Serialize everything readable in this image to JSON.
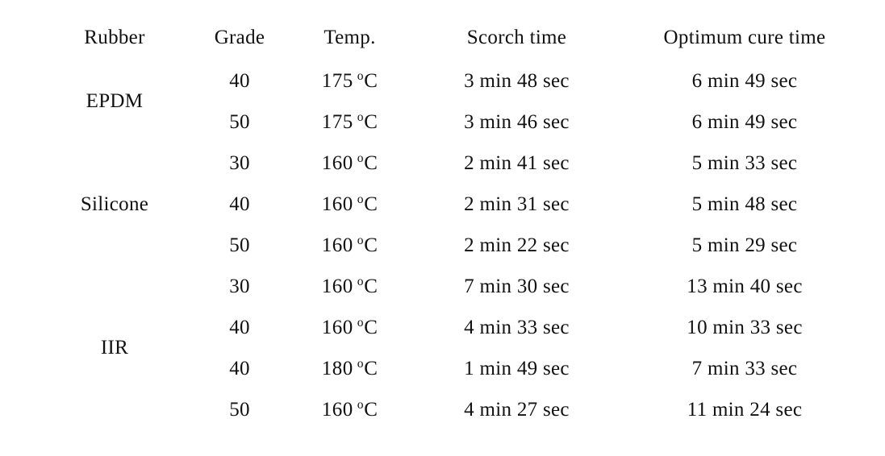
{
  "table": {
    "name": "rubber-cure-characteristics-table",
    "columns": [
      {
        "key": "rubber",
        "label": "Rubber"
      },
      {
        "key": "grade",
        "label": "Grade"
      },
      {
        "key": "temp",
        "label": "Temp."
      },
      {
        "key": "scorch",
        "label": "Scorch time"
      },
      {
        "key": "optimum",
        "label": "Optimum cure time"
      }
    ],
    "groups": [
      {
        "rubber": "EPDM",
        "rows": [
          {
            "grade": "40",
            "temp_value": "175",
            "temp_unit": "C",
            "scorch": "3 min 48 sec",
            "optimum": "6 min 49 sec"
          },
          {
            "grade": "50",
            "temp_value": "175",
            "temp_unit": "C",
            "scorch": "3 min 46 sec",
            "optimum": "6 min 49 sec"
          }
        ]
      },
      {
        "rubber": "Silicone",
        "rows": [
          {
            "grade": "30",
            "temp_value": "160",
            "temp_unit": "C",
            "scorch": "2 min 41 sec",
            "optimum": "5 min 33 sec"
          },
          {
            "grade": "40",
            "temp_value": "160",
            "temp_unit": "C",
            "scorch": "2 min 31 sec",
            "optimum": "5 min 48 sec"
          },
          {
            "grade": "50",
            "temp_value": "160",
            "temp_unit": "C",
            "scorch": "2 min 22 sec",
            "optimum": "5 min 29 sec"
          }
        ]
      },
      {
        "rubber": "IIR",
        "rows": [
          {
            "grade": "30",
            "temp_value": "160",
            "temp_unit": "C",
            "scorch": "7 min 30 sec",
            "optimum": "13 min 40 sec"
          },
          {
            "grade": "40",
            "temp_value": "160",
            "temp_unit": "C",
            "scorch": "4 min 33 sec",
            "optimum": "10 min 33 sec"
          },
          {
            "grade": "40",
            "temp_value": "180",
            "temp_unit": "C",
            "scorch": "1 min 49 sec",
            "optimum": "7 min 33 sec"
          },
          {
            "grade": "50",
            "temp_value": "160",
            "temp_unit": "C",
            "scorch": "4 min 27 sec",
            "optimum": "11 min 24 sec"
          }
        ]
      }
    ],
    "degree_mark": "o"
  }
}
